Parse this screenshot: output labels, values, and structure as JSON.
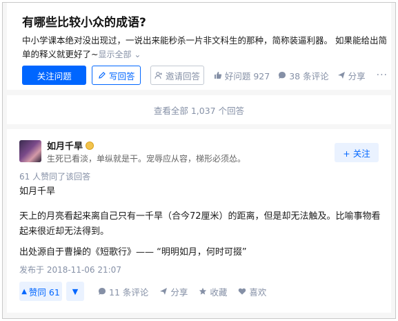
{
  "question": {
    "title": "有哪些比较小众的成语?",
    "detail": "中小学课本绝对没出现过，一说出来能秒杀一片非文科生的那种，简称装逼利器。 如果能给出简单的释义就更好了~",
    "show_all": "显示全部",
    "follow_button": "关注问题",
    "write_answer_button": "写回答",
    "invite_button": "邀请回答",
    "good_question": "好问题 927",
    "comments": "38 条评论",
    "share": "分享",
    "more": "···"
  },
  "view_all": {
    "label": "查看全部 1,037 个回答"
  },
  "answer": {
    "author": {
      "name": "如月千旱",
      "bio": "生死已看淡，单纵就是干。宠辱应从容，梯形必须怂。"
    },
    "follow_button": "+ 关注",
    "upvote_note": "61 人赞同了该回答",
    "paragraphs": [
      "如月千旱",
      "天上的月亮看起来离自己只有一千旱（合今72厘米）的距离，但是却无法触及。比喻事物看起来很近却无法得到。",
      "出处源自于曹操的《短歌行》——  “明明如月，何时可掇”"
    ],
    "published": "发布于 2018-11-06 21:07",
    "actions": {
      "upvote": "赞同 61",
      "comments": "11 条评论",
      "share": "分享",
      "favorite": "收藏",
      "like": "喜欢"
    }
  },
  "colors": {
    "accent": "#0066ff",
    "muted": "#8590a6",
    "background": "#f6f6f6",
    "accent_light": "#eaf2ff"
  }
}
